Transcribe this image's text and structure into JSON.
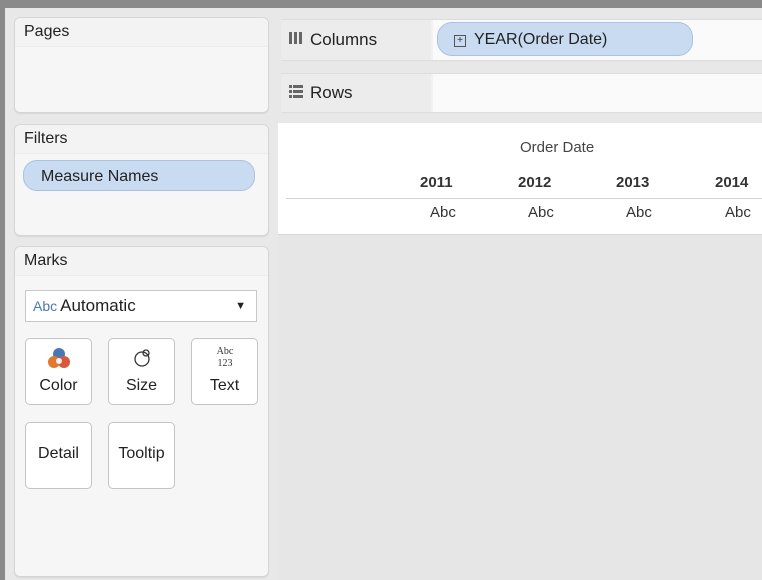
{
  "pages": {
    "title": "Pages"
  },
  "filters": {
    "title": "Filters",
    "items": [
      "Measure Names"
    ]
  },
  "marks": {
    "title": "Marks",
    "mark_type": {
      "icon": "Abc",
      "value": "Automatic"
    },
    "buttons": [
      {
        "label": "Color",
        "icon": "color-circles-icon"
      },
      {
        "label": "Size",
        "icon": "size-circles-icon"
      },
      {
        "label": "Text",
        "icon_text": "Abc\n123"
      },
      {
        "label": "Detail"
      },
      {
        "label": "Tooltip"
      }
    ]
  },
  "shelves": {
    "columns": {
      "label": "Columns",
      "pill": "YEAR(Order Date)",
      "pill_icon": "⊞"
    },
    "rows": {
      "label": "Rows"
    }
  },
  "view": {
    "header": "Order Date",
    "years": [
      "2011",
      "2012",
      "2013",
      "2014"
    ],
    "cells": [
      "Abc",
      "Abc",
      "Abc",
      "Abc"
    ]
  },
  "colors": {
    "pill": "#c9dbf1",
    "accent": "#4a78b5"
  }
}
